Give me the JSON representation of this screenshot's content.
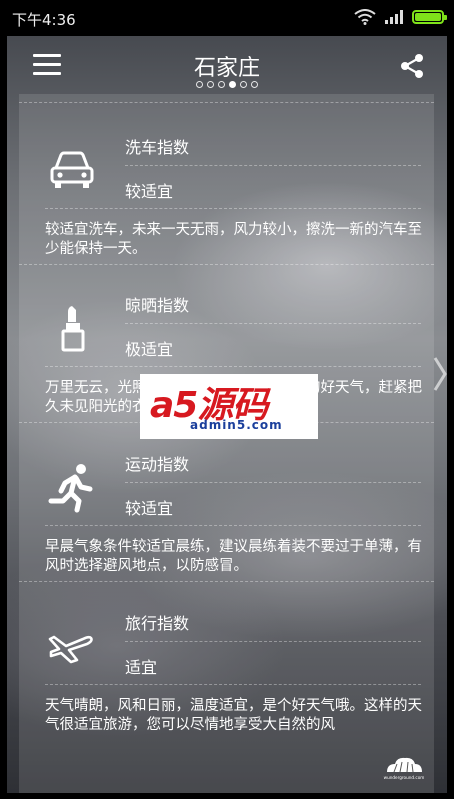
{
  "status_bar": {
    "time": "下午4:36"
  },
  "header": {
    "city": "石家庄",
    "pages_total": 6,
    "pages_active_index": 3
  },
  "indices": [
    {
      "name": "洗车指数",
      "level": "较适宜",
      "icon": "car-icon",
      "description": "较适宜洗车，未来一天无雨，风力较小，擦洗一新的汽车至少能保持一天。"
    },
    {
      "name": "晾晒指数",
      "level": "极适宜",
      "icon": "lipstick-icon",
      "description": "万里无云，光照充足，风力适宜，是晾晒的好天气，赶紧把久未见阳光的衣物搬出来"
    },
    {
      "name": "运动指数",
      "level": "较适宜",
      "icon": "running-icon",
      "description": "早晨气象条件较适宜晨练，建议晨练着装不要过于单薄，有风时选择避风地点，以防感冒。"
    },
    {
      "name": "旅行指数",
      "level": "适宜",
      "icon": "airplane-icon",
      "description": "天气晴朗，风和日丽，温度适宜，是个好天气哦。这样的天气很适宜旅游，您可以尽情地享受大自然的风"
    }
  ],
  "watermark": {
    "main": "a5源码",
    "sub": "admin5.com"
  },
  "footer": {
    "logo_text": "wunderground.com"
  }
}
